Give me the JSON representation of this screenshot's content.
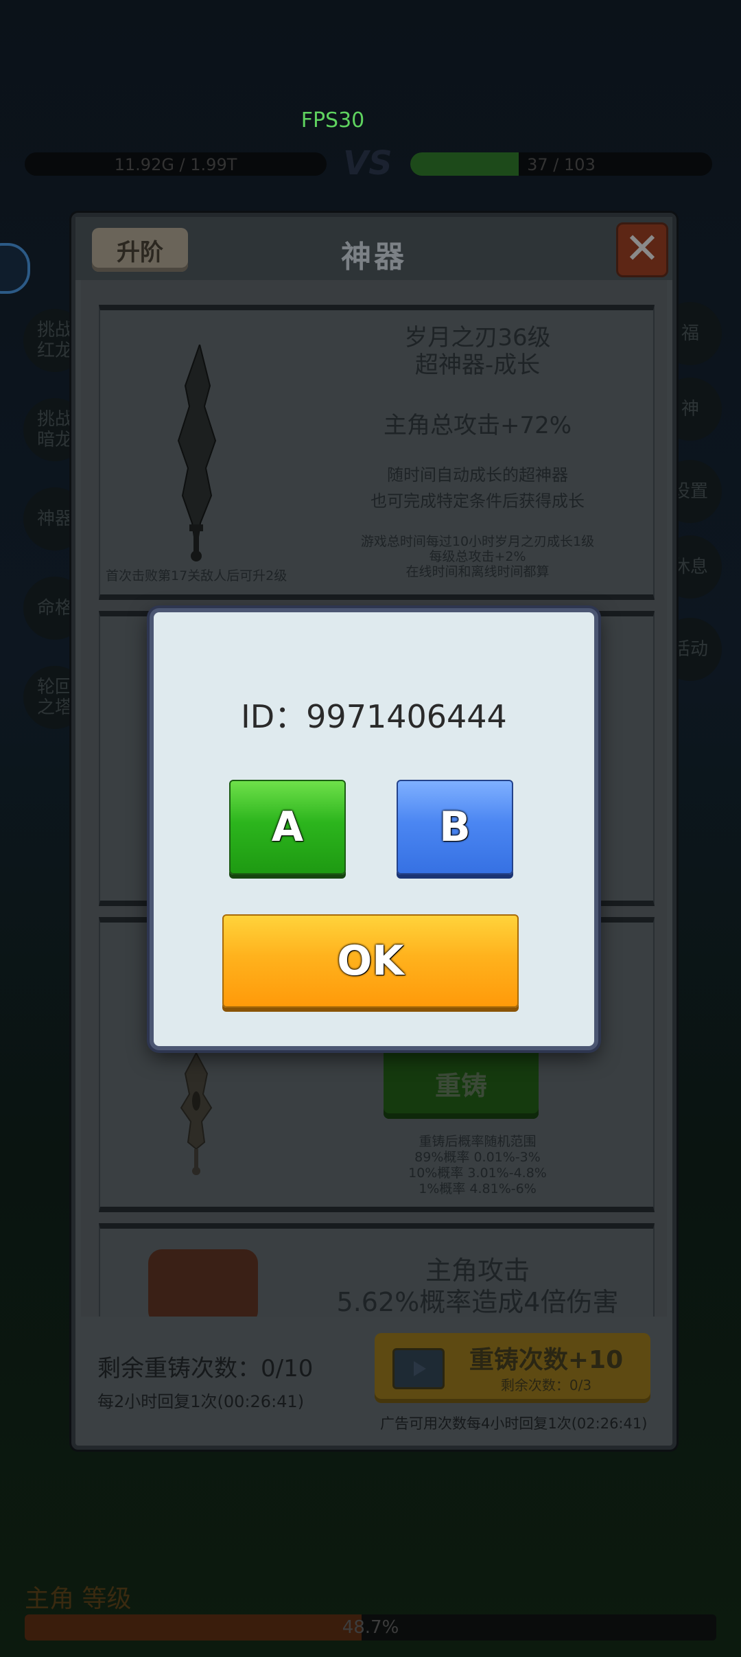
{
  "hud": {
    "fps": "FPS30",
    "player_hp": "11.92G / 1.99T",
    "vs": "VS",
    "enemy_hp": "37 / 103",
    "enemy_hp_fraction": 0.36
  },
  "side_left": [
    "挑战\n红龙",
    "挑战\n暗龙",
    "神器",
    "命格",
    "轮回\n之塔"
  ],
  "side_right": [
    "福",
    "神",
    "设置",
    "休息",
    "活动"
  ],
  "bottom": {
    "hero_label": "主角 等级",
    "progress_text": "48.7%",
    "progress_fraction": 0.487
  },
  "panel": {
    "title": "神器",
    "upgrade_label": "升阶",
    "close_icon": "✕",
    "card1": {
      "name": "岁月之刃36级",
      "type": "超神器-成长",
      "bonus": "主角总攻击+72%",
      "desc1": "随时间自动成长的超神器",
      "desc2": "也可完成特定条件后获得成长",
      "note1": "游戏总时间每过10小时岁月之刃成长1级",
      "note2": "每级总攻击+2%",
      "note3": "在线时间和离线时间都算",
      "footnote": "首次击败第17关敌人后可升2级"
    },
    "card3": {
      "reforge_label": "重铸",
      "reforge_lines": [
        "重铸后概率随机范围",
        "89%概率 0.01%-3%",
        "10%概率 3.01%-4.8%",
        "1%概率 4.81%-6%"
      ]
    },
    "card4": {
      "line1": "主角攻击",
      "line2": "5.62%概率造成4倍伤害"
    },
    "footer": {
      "remaining": "剩余重铸次数：0/10",
      "recover": "每2小时回复1次(00:26:41)",
      "ad_title": "重铸次数+10",
      "ad_sub": "剩余次数：0/3",
      "ad_note": "广告可用次数每4小时回复1次(02:26:41)"
    }
  },
  "dialog": {
    "id_text": "ID：9971406444",
    "a_label": "A",
    "b_label": "B",
    "ok_label": "OK"
  }
}
